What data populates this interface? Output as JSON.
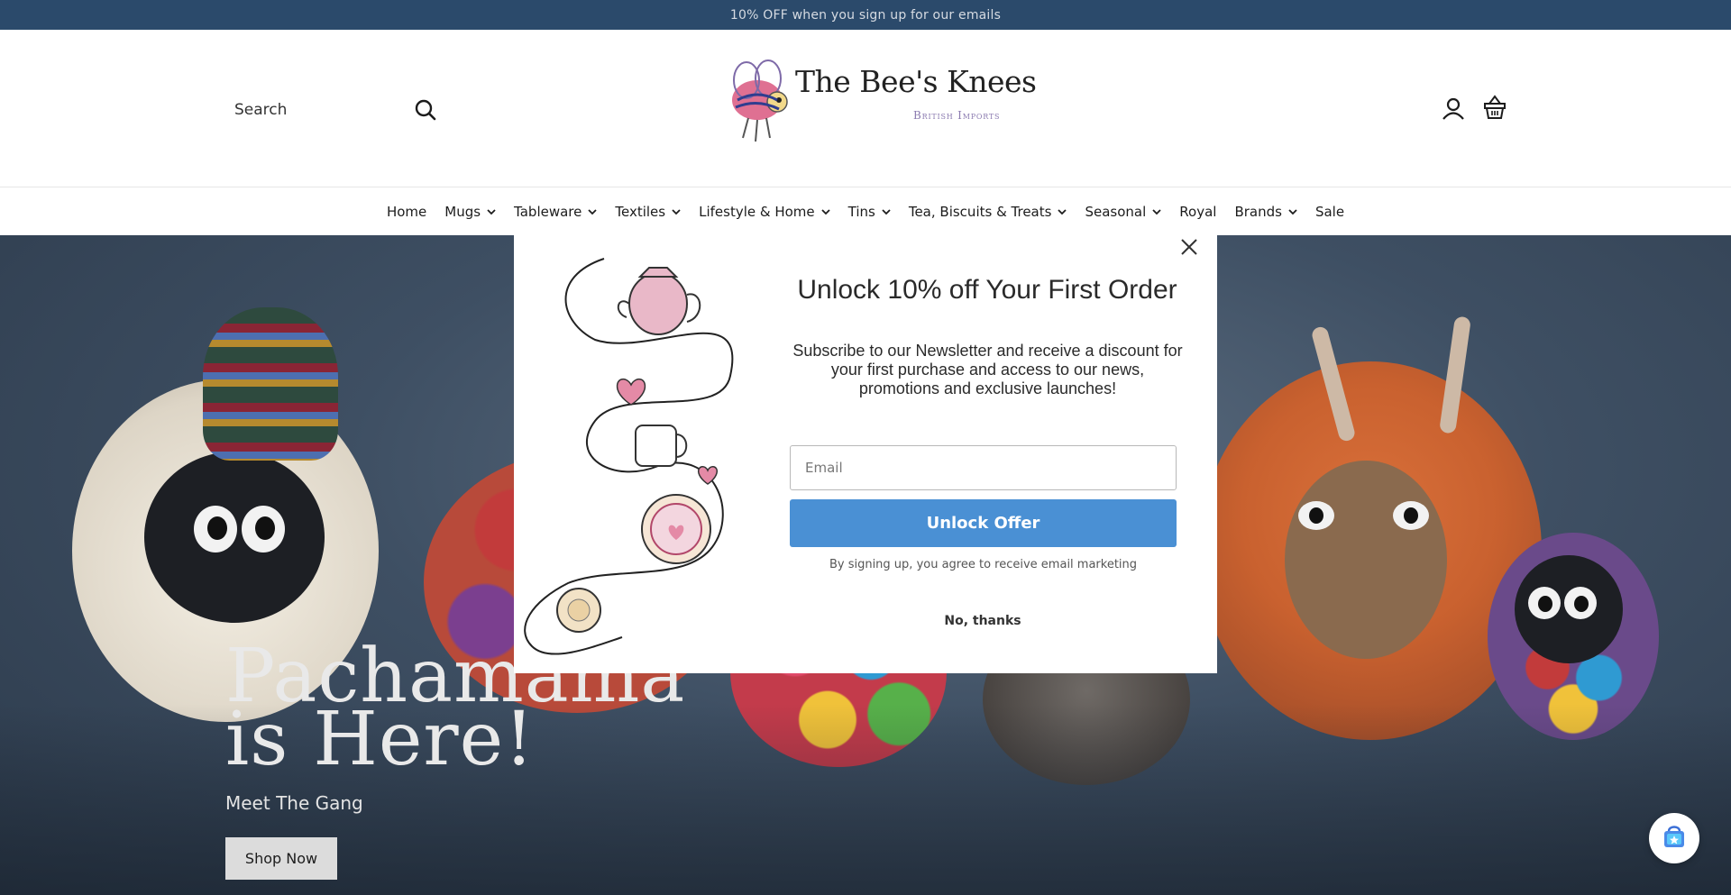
{
  "announcement": {
    "text": "10% OFF when you sign up for our emails"
  },
  "header": {
    "search_placeholder": "Search",
    "logo": {
      "title": "The Bee's Knees",
      "subtitle": "British Imports"
    }
  },
  "nav": {
    "items": [
      {
        "label": "Home",
        "dropdown": false
      },
      {
        "label": "Mugs",
        "dropdown": true
      },
      {
        "label": "Tableware",
        "dropdown": true
      },
      {
        "label": "Textiles",
        "dropdown": true
      },
      {
        "label": "Lifestyle & Home",
        "dropdown": true
      },
      {
        "label": "Tins",
        "dropdown": true
      },
      {
        "label": "Tea, Biscuits & Treats",
        "dropdown": true
      },
      {
        "label": "Seasonal",
        "dropdown": true
      },
      {
        "label": "Royal",
        "dropdown": false
      },
      {
        "label": "Brands",
        "dropdown": true
      },
      {
        "label": "Sale",
        "dropdown": false
      }
    ]
  },
  "hero": {
    "title_line1": "Pachamama",
    "title_line2": "is Here!",
    "subtitle": "Meet The Gang",
    "button_label": "Shop Now"
  },
  "modal": {
    "title": "Unlock 10% off Your First Order",
    "body": "Subscribe to our Newsletter and receive a discount for your first purchase and access to our news, promotions and exclusive launches!",
    "email_placeholder": "Email",
    "submit_label": "Unlock Offer",
    "terms": "By signing up, you agree to receive email marketing",
    "dismiss_label": "No, thanks"
  },
  "colors": {
    "announcement_bg": "#2b4a6b",
    "accent_button": "#4a90d4",
    "hero_bg": "#3e4f63"
  },
  "icons": [
    "search-icon",
    "account-icon",
    "basket-icon",
    "chevron-down-icon",
    "close-icon",
    "shop-bag-icon"
  ]
}
